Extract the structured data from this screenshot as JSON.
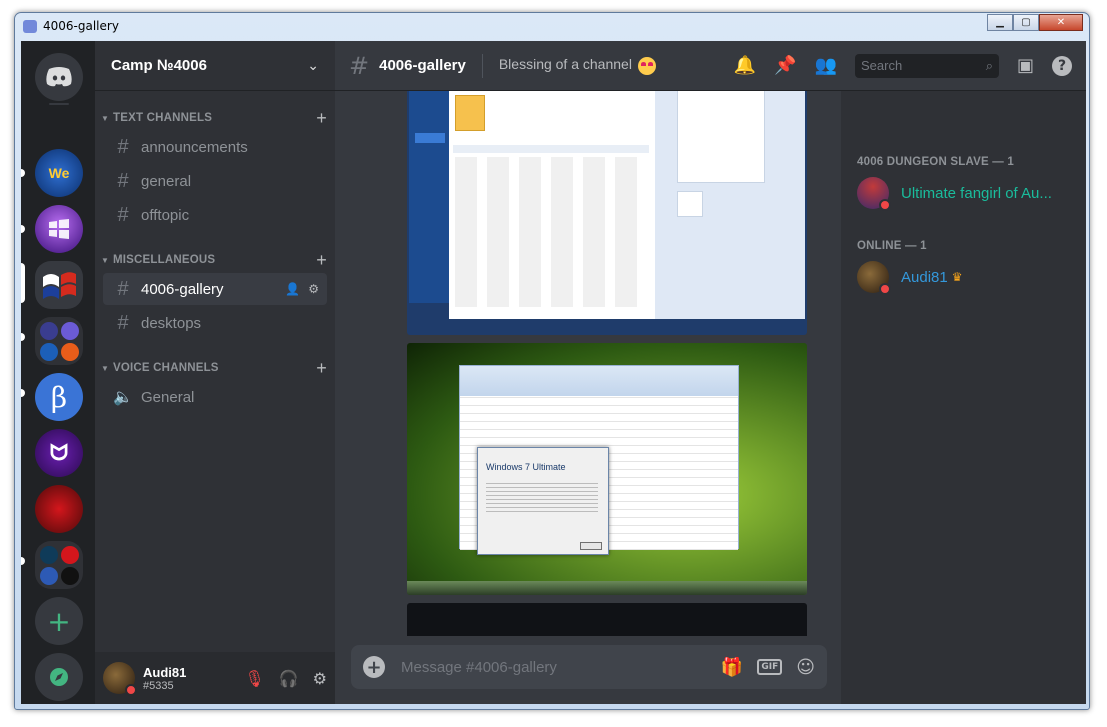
{
  "window": {
    "title": "4006-gallery"
  },
  "guild": {
    "name": "Camp №4006"
  },
  "categories": {
    "text": "TEXT CHANNELS",
    "misc": "MISCELLANEOUS",
    "voice": "VOICE CHANNELS"
  },
  "channels": {
    "text": [
      "announcements",
      "general",
      "offtopic"
    ],
    "misc": [
      "4006-gallery",
      "desktops"
    ],
    "voice": [
      "General"
    ]
  },
  "user": {
    "name": "Audi81",
    "tag": "#5335"
  },
  "chat": {
    "channel_name": "4006-gallery",
    "topic": "Blessing of a channel",
    "search_placeholder": "Search",
    "composer_placeholder": "Message #4006-gallery",
    "gif_label": "GIF"
  },
  "members": {
    "role_header": "4006 DUNGEON SLAVE — 1",
    "online_header": "ONLINE — 1",
    "role_member": "Ultimate fangirl of Au...",
    "online_member": "Audi81",
    "role_color": "#1abc9c",
    "online_color": "#3498db"
  },
  "screenshot2": {
    "dialog_title": "Windows 7 Ultimate"
  },
  "colors": {
    "background": "#36393f",
    "sidebar": "#2f3136",
    "server_rail": "#202225",
    "accent": "#7289da",
    "online_green": "#43b581",
    "dnd_red": "#f04747"
  }
}
